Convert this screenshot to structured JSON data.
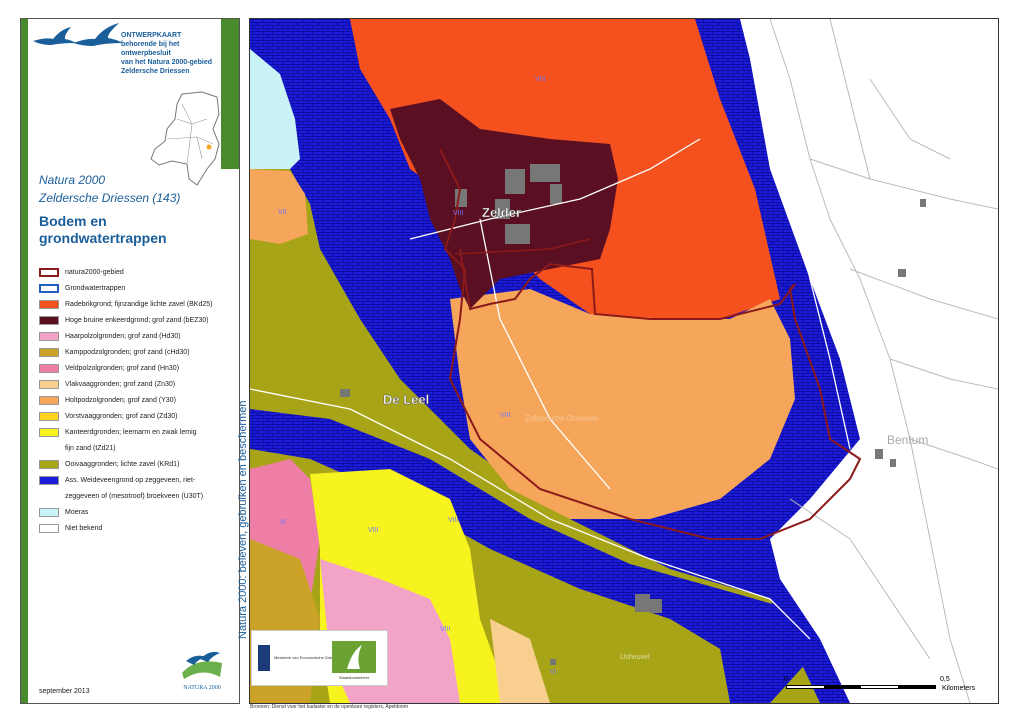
{
  "sidebar": {
    "ontwerpkaart": "ONTWERPKAART",
    "subtitle_1": "behorende bij het ontwerpbesluit",
    "subtitle_2": "van het Natura 2000-gebied",
    "subtitle_3": "Zeldersche Driessen",
    "program": "Natura 2000",
    "area_name": "Zeldersche Driessen (143)",
    "heading_1": "Bodem en",
    "heading_2": "grondwatertrappen",
    "vertical_title": "Natura 2000: beleven, gebruiken en beschermen",
    "date": "september 2013",
    "logo_text": "NATURA 2000"
  },
  "legend": [
    {
      "label": "natura2000-gebied",
      "color": "#ffffff",
      "border": "#8b1a1a"
    },
    {
      "label": "Grondwatertrappen",
      "color": "#ffffff",
      "border": "#1e5fbf"
    },
    {
      "label": "Radebrikgrond; fijnzandige lichte zavel (BKd25)",
      "color": "#f5511e"
    },
    {
      "label": "Hoge bruine enkeerdgrond; grof zand (bEZ30)",
      "color": "#5a0f22"
    },
    {
      "label": "Haarpolzolgronden; grof zand (Hd30)",
      "color": "#f3a3c6"
    },
    {
      "label": "Kamppodzolgronden; grof zand (cHd30)",
      "color": "#c9a227"
    },
    {
      "label": "Veldpolzolgronden; grof zand (Hn30)",
      "color": "#ef7ea6"
    },
    {
      "label": "Vlakvaaggronden; grof zand (Zn30)",
      "color": "#f9cf90"
    },
    {
      "label": "Holtpodzolgronden; grof zand (Y30)",
      "color": "#f5a65a"
    },
    {
      "label": "Vorstvaaggronden; grof zand (Zd30)",
      "color": "#ffd21f"
    },
    {
      "label": "Kanteerdgronden; leemarm en zwak lemig",
      "label2": "fijn zand (tZd21)",
      "color": "#f7f31f"
    },
    {
      "label": "Ooivaaggronden; lichte zavel (KRd1)",
      "color": "#a8a417"
    },
    {
      "label": "Ass. Weideveengrond op zeggeveen, riet-",
      "label2": "zeggeveen of (mesotroof) broekveen (U30T)",
      "color": "#1c1cd8"
    },
    {
      "label": "Moeras",
      "color": "#c9f3f7"
    },
    {
      "label": "Niet bekend",
      "color": "#ffffff"
    }
  ],
  "map": {
    "place_zelder": "Zelder",
    "place_de_leel": "De Leel",
    "place_bentum": "Bentum",
    "area_label": "Zeldersche Driessen",
    "place_ijsheuvel": "IJsheuvel",
    "gwt_labels": [
      "VIII",
      "VII",
      "VIII",
      "VIII",
      "III",
      "VIII",
      "VIII",
      "VIII",
      "VI"
    ]
  },
  "scale": {
    "zero": "0",
    "half": "0,5",
    "unit": "Kilometers"
  },
  "source": "Bronnen: Dienst voor het kadaster en de openbare registers, Apeldoorn",
  "logos": {
    "rijk": "Ministerie van Economische Zaken",
    "sbb": "Staatsbosbeheer"
  }
}
